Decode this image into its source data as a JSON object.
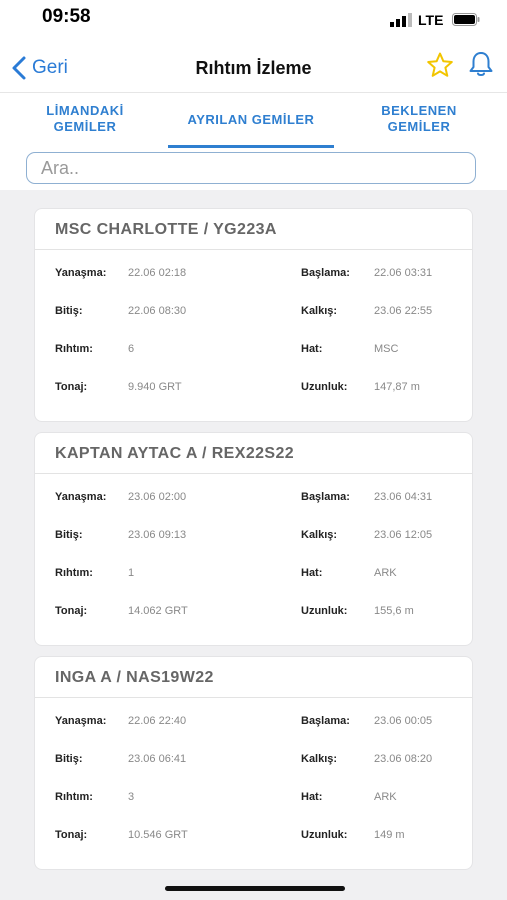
{
  "status_bar": {
    "time": "09:58",
    "network": "LTE"
  },
  "nav": {
    "back_label": "Geri",
    "title": "Rıhtım İzleme",
    "icons": [
      "star-icon",
      "bell-icon"
    ]
  },
  "tabs": [
    {
      "line1": "LİMANDAKİ",
      "line2": "GEMİLER",
      "active": false
    },
    {
      "line1": "AYRILAN GEMİLER",
      "line2": "",
      "active": true
    },
    {
      "line1": "BEKLENEN",
      "line2": "GEMİLER",
      "active": false
    }
  ],
  "search": {
    "placeholder": "Ara.."
  },
  "labels": {
    "yanasma": "Yanaşma:",
    "baslama": "Başlama:",
    "bitis": "Bitiş:",
    "kalkis": "Kalkış:",
    "rihtim": "Rıhtım:",
    "hat": "Hat:",
    "tonaj": "Tonaj:",
    "uzunluk": "Uzunluk:"
  },
  "ships": [
    {
      "title": "MSC CHARLOTTE / YG223A",
      "yanasma": "22.06 02:18",
      "baslama": "22.06 03:31",
      "bitis": "22.06 08:30",
      "kalkis": "23.06 22:55",
      "rihtim": "6",
      "hat": "MSC",
      "tonaj": "9.940 GRT",
      "uzunluk": "147,87 m"
    },
    {
      "title": "KAPTAN AYTAC A / REX22S22",
      "yanasma": "23.06 02:00",
      "baslama": "23.06 04:31",
      "bitis": "23.06 09:13",
      "kalkis": "23.06 12:05",
      "rihtim": "1",
      "hat": "ARK",
      "tonaj": "14.062 GRT",
      "uzunluk": "155,6 m"
    },
    {
      "title": "INGA A / NAS19W22",
      "yanasma": "22.06 22:40",
      "baslama": "23.06 00:05",
      "bitis": "23.06 06:41",
      "kalkis": "23.06 08:20",
      "rihtim": "3",
      "hat": "ARK",
      "tonaj": "10.546 GRT",
      "uzunluk": "149 m"
    }
  ],
  "colors": {
    "accent": "#2f7fd0",
    "star": "#f2c500",
    "background": "#f0f0f2"
  }
}
